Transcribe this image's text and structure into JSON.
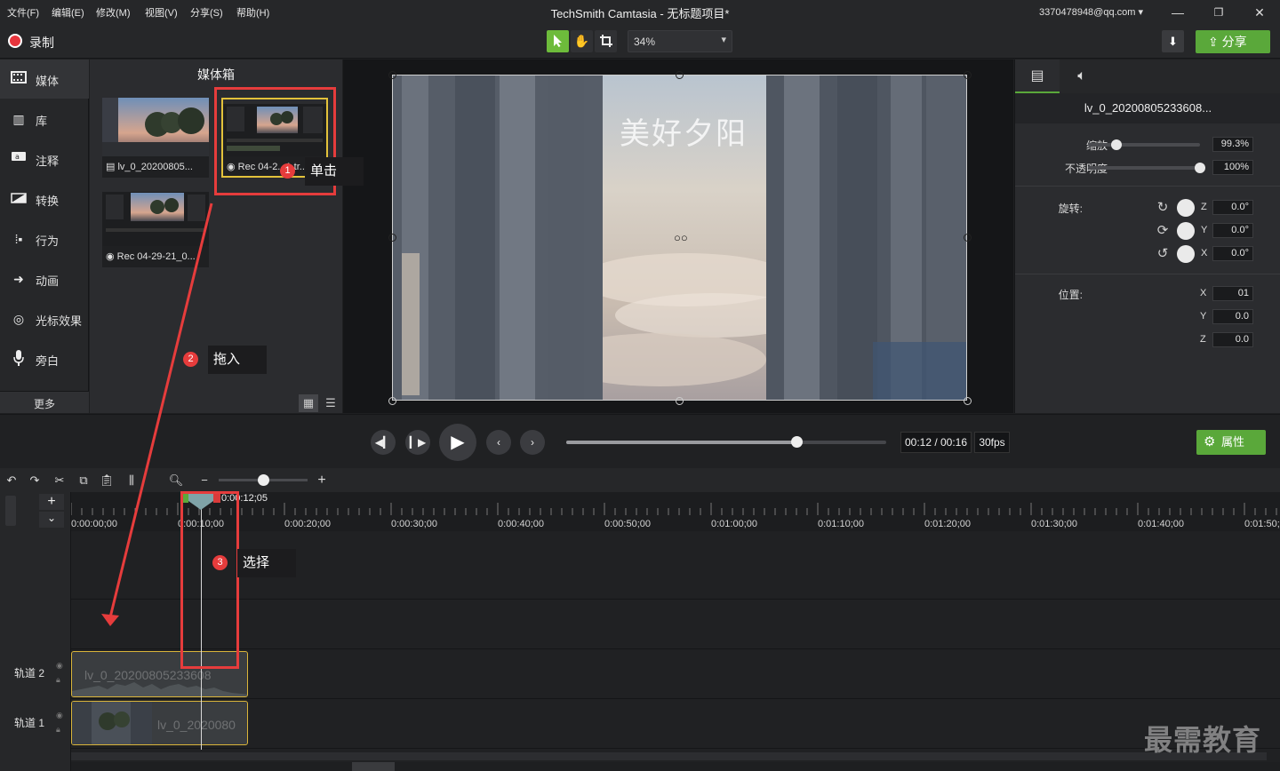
{
  "menubar": {
    "items": [
      "文件(F)",
      "编辑(E)",
      "修改(M)",
      "视图(V)",
      "分享(S)",
      "帮助(H)"
    ],
    "title": "TechSmith Camtasia - 无标题项目*",
    "account": "3370478948@qq.com",
    "account_caret": "▾"
  },
  "toolbar": {
    "record_label": "录制",
    "zoom": "34%",
    "share_label": "分享"
  },
  "sidebar": {
    "items": [
      {
        "label": "媒体",
        "icon": "film-icon"
      },
      {
        "label": "库",
        "icon": "library-icon"
      },
      {
        "label": "注释",
        "icon": "annotation-icon"
      },
      {
        "label": "转换",
        "icon": "transition-icon"
      },
      {
        "label": "行为",
        "icon": "behavior-icon"
      },
      {
        "label": "动画",
        "icon": "animation-icon"
      },
      {
        "label": "光标效果",
        "icon": "cursor-effect-icon"
      },
      {
        "label": "旁白",
        "icon": "microphone-icon"
      }
    ],
    "more_label": "更多"
  },
  "bin": {
    "title": "媒体箱",
    "items": [
      {
        "label": "lv_0_20200805..."
      },
      {
        "label": "Rec 04-2...1.tr..."
      },
      {
        "label": "Rec 04-29-21_0..."
      }
    ]
  },
  "preview": {
    "overlay_text": "美好夕阳"
  },
  "properties": {
    "clip_name": "lv_0_20200805233608...",
    "scale_label": "缩放",
    "scale_value": "99.3%",
    "scale_level": 0.25,
    "opacity_label": "不透明度",
    "opacity_value": "100%",
    "opacity_level": 1.0,
    "rotation_label": "旋转:",
    "rotation": [
      {
        "axis": "Z",
        "value": "0.0°"
      },
      {
        "axis": "Y",
        "value": "0.0°"
      },
      {
        "axis": "X",
        "value": "0.0°"
      }
    ],
    "position_label": "位置:",
    "position": [
      {
        "axis": "X",
        "value": "01"
      },
      {
        "axis": "Y",
        "value": "0.0"
      },
      {
        "axis": "Z",
        "value": "0.0"
      }
    ]
  },
  "transport": {
    "time": "00:12 / 00:16",
    "fps": "30fps",
    "progress": 0.72,
    "properties_label": "属性"
  },
  "timeline": {
    "playhead_time": "0:00:12;05",
    "ticks": [
      "0:00:00;00",
      "0:00:10;00",
      "0:00:20;00",
      "0:00:30;00",
      "0:00:40;00",
      "0:00:50;00",
      "0:01:00;00",
      "0:01:10;00",
      "0:01:20;00",
      "0:01:30;00",
      "0:01:40;00",
      "0:01:50;00"
    ],
    "tracks": [
      {
        "name": "轨道 2",
        "clip": "lv_0_20200805233608"
      },
      {
        "name": "轨道 1",
        "clip": "lv_0_2020080"
      }
    ]
  },
  "annotations": {
    "step1_num": "1",
    "step1_text": "单击",
    "step2_num": "2",
    "step2_text": "拖入",
    "step3_num": "3",
    "step3_text": "选择"
  },
  "watermark": "最需教育"
}
